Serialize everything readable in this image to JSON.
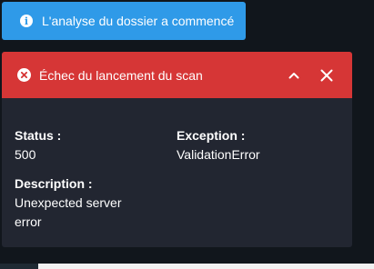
{
  "info_toast": {
    "icon": "info-icon",
    "message": "L'analyse du dossier a commencé",
    "color": "#2f9ae8"
  },
  "error_panel": {
    "icon": "error-circle-icon",
    "title": "Échec du lancement du scan",
    "header_color": "#d63636",
    "collapse_icon": "chevron-up-icon",
    "close_icon": "close-icon",
    "fields": {
      "status_label": "Status :",
      "status_value": "500",
      "exception_label": "Exception :",
      "exception_value": "ValidationError",
      "description_label": "Description :",
      "description_value": "Unexpected server error"
    }
  }
}
